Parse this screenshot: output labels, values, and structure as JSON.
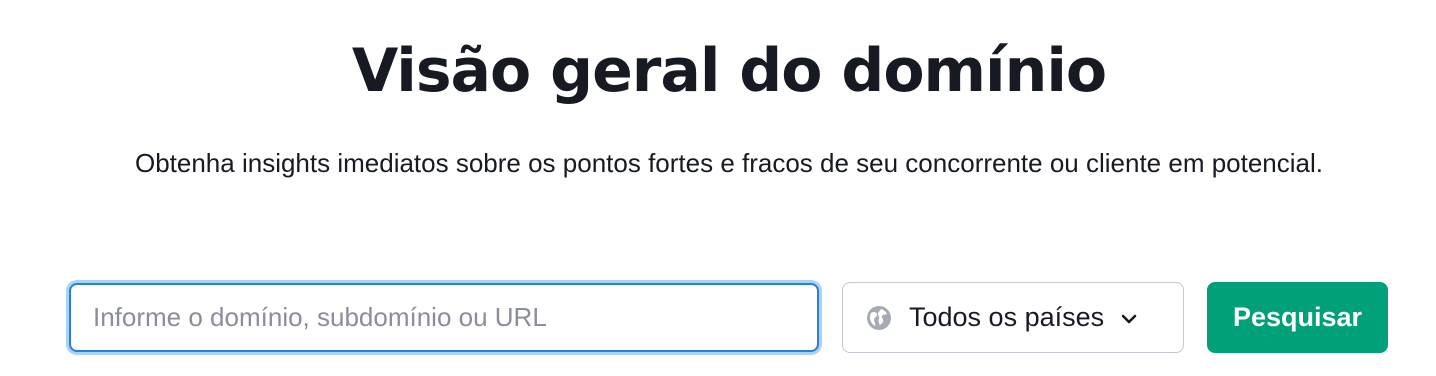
{
  "header": {
    "title": "Visão geral do domínio",
    "subtitle": "Obtenha insights imediatos sobre os pontos fortes e fracos de seu concorrente ou cliente em potencial."
  },
  "search": {
    "input_value": "",
    "input_placeholder": "Informe o domínio, subdomínio ou URL",
    "country_selected": "Todos os países",
    "country_icon": "globe-icon",
    "dropdown_icon": "chevron-down-icon",
    "button_label": "Pesquisar"
  },
  "colors": {
    "text": "#171a22",
    "placeholder": "#8a8e9b",
    "input_focus_border": "#2d7fd6",
    "input_focus_ring": "#a9d2f7",
    "select_border": "#c2c7cd",
    "button_bg": "#00a179",
    "button_text": "#ffffff",
    "globe": "#a6aab3"
  }
}
